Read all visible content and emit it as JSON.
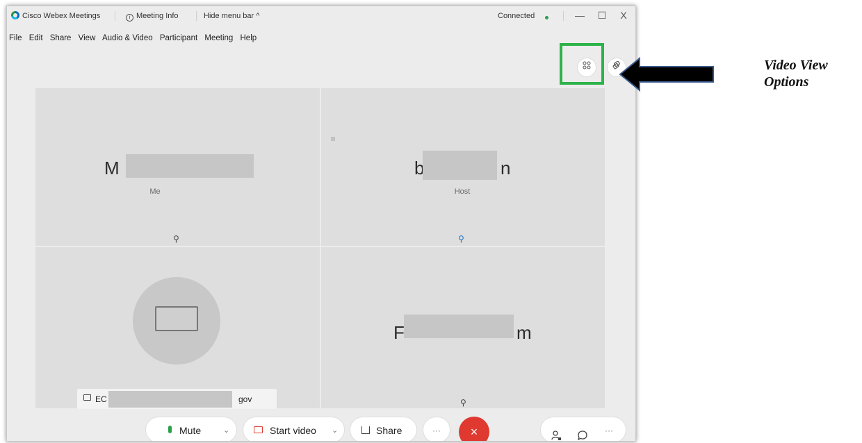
{
  "titlebar": {
    "app_title": "Cisco Webex Meetings",
    "meeting_info": "Meeting Info",
    "hide_menu_bar": "Hide menu bar ^",
    "connection_status": "Connected",
    "minimize": "—",
    "maximize": "☐",
    "close": "X"
  },
  "menu": [
    "File",
    "Edit",
    "Share",
    "View",
    "Audio & Video",
    "Participant",
    "Meeting",
    "Help"
  ],
  "view_controls": {
    "grid_icon": "grid-icon",
    "layout_icon": "layout-icon"
  },
  "tiles": [
    {
      "name_visible": "M",
      "name_suffix": "",
      "role": "Me"
    },
    {
      "name_visible": "b",
      "name_suffix": "n",
      "role": "Host"
    },
    {
      "label_visible": "EC",
      "label_suffix": "gov"
    },
    {
      "name_visible": "F",
      "name_suffix": "m"
    }
  ],
  "controls": {
    "mute": "Mute",
    "start_video": "Start video",
    "share": "Share",
    "more": "···",
    "end": "×",
    "more_right": "···"
  },
  "annotation": {
    "line1": "Video View",
    "line2": "Options"
  },
  "colors": {
    "highlight": "#2db34a",
    "end_call": "#e0392f",
    "connected": "#2aa04a",
    "arrow": "#000000"
  }
}
